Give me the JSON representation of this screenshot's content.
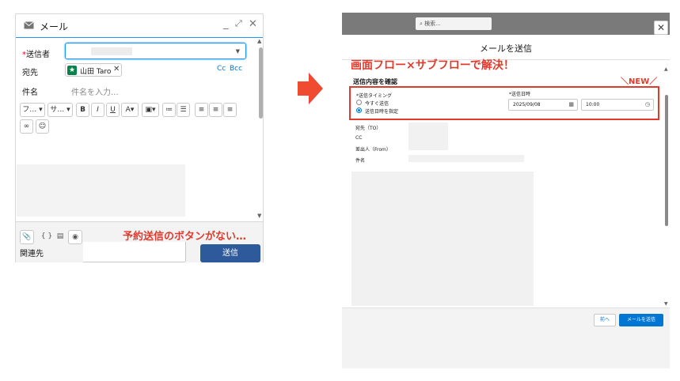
{
  "colors": {
    "brand_blue": "#0176d3",
    "annotation_red": "#e03a2d",
    "send_button": "#2e5a9c",
    "avatar_green": "#04844b"
  },
  "left_panel": {
    "icon": "mail-icon",
    "title": "メール",
    "minimize": "_",
    "expand": "⤢",
    "close": "✕",
    "sender": {
      "required_mark": "*",
      "label": "送信者"
    },
    "to": {
      "label": "宛先",
      "recipient": "山田 Taro",
      "remove": "✕",
      "avatar_icon": "star-icon"
    },
    "cc_label": "Cc",
    "bcc_label": "Bcc",
    "subject": {
      "label": "件名",
      "placeholder": "件名を入力..."
    },
    "toolbar": {
      "font": "フ…",
      "size": "サ…",
      "bold": "B",
      "italic": "I",
      "underline": "U",
      "color": "A",
      "image": "▣",
      "numbered_list": "≔",
      "bullet_list": "☰",
      "align_left": "≡",
      "align_center": "≡",
      "align_right": "≡",
      "link": "∞",
      "emoji": "☺"
    },
    "footer": {
      "attach": "📎",
      "merge_field": "{ }",
      "template": "▤",
      "preview": "◉",
      "annotation": "予約送信のボタンがない…",
      "related_label": "関連先",
      "send_button": "送信"
    }
  },
  "arrow_icon": "right-arrow-icon",
  "right_panel": {
    "search_placeholder": "検索...",
    "close": "✕",
    "modal_title": "メールを送信",
    "annotation": "画面フロー×サブフローで解決！",
    "section_title": "送信内容を確認",
    "new_mark": "＼NEW／",
    "timing": {
      "label": "*送信タイミング",
      "options": [
        "今すぐ送信",
        "送信日時を指定"
      ],
      "selected": 1
    },
    "datetime": {
      "label": "*送信日時",
      "date": "2025/09/08",
      "time": "10:00"
    },
    "fields": {
      "to": "宛先（TO）",
      "cc": "CC",
      "from": "差出人（From）",
      "subject": "件名"
    },
    "footer": {
      "prev": "前へ",
      "send": "メールを送信"
    }
  }
}
